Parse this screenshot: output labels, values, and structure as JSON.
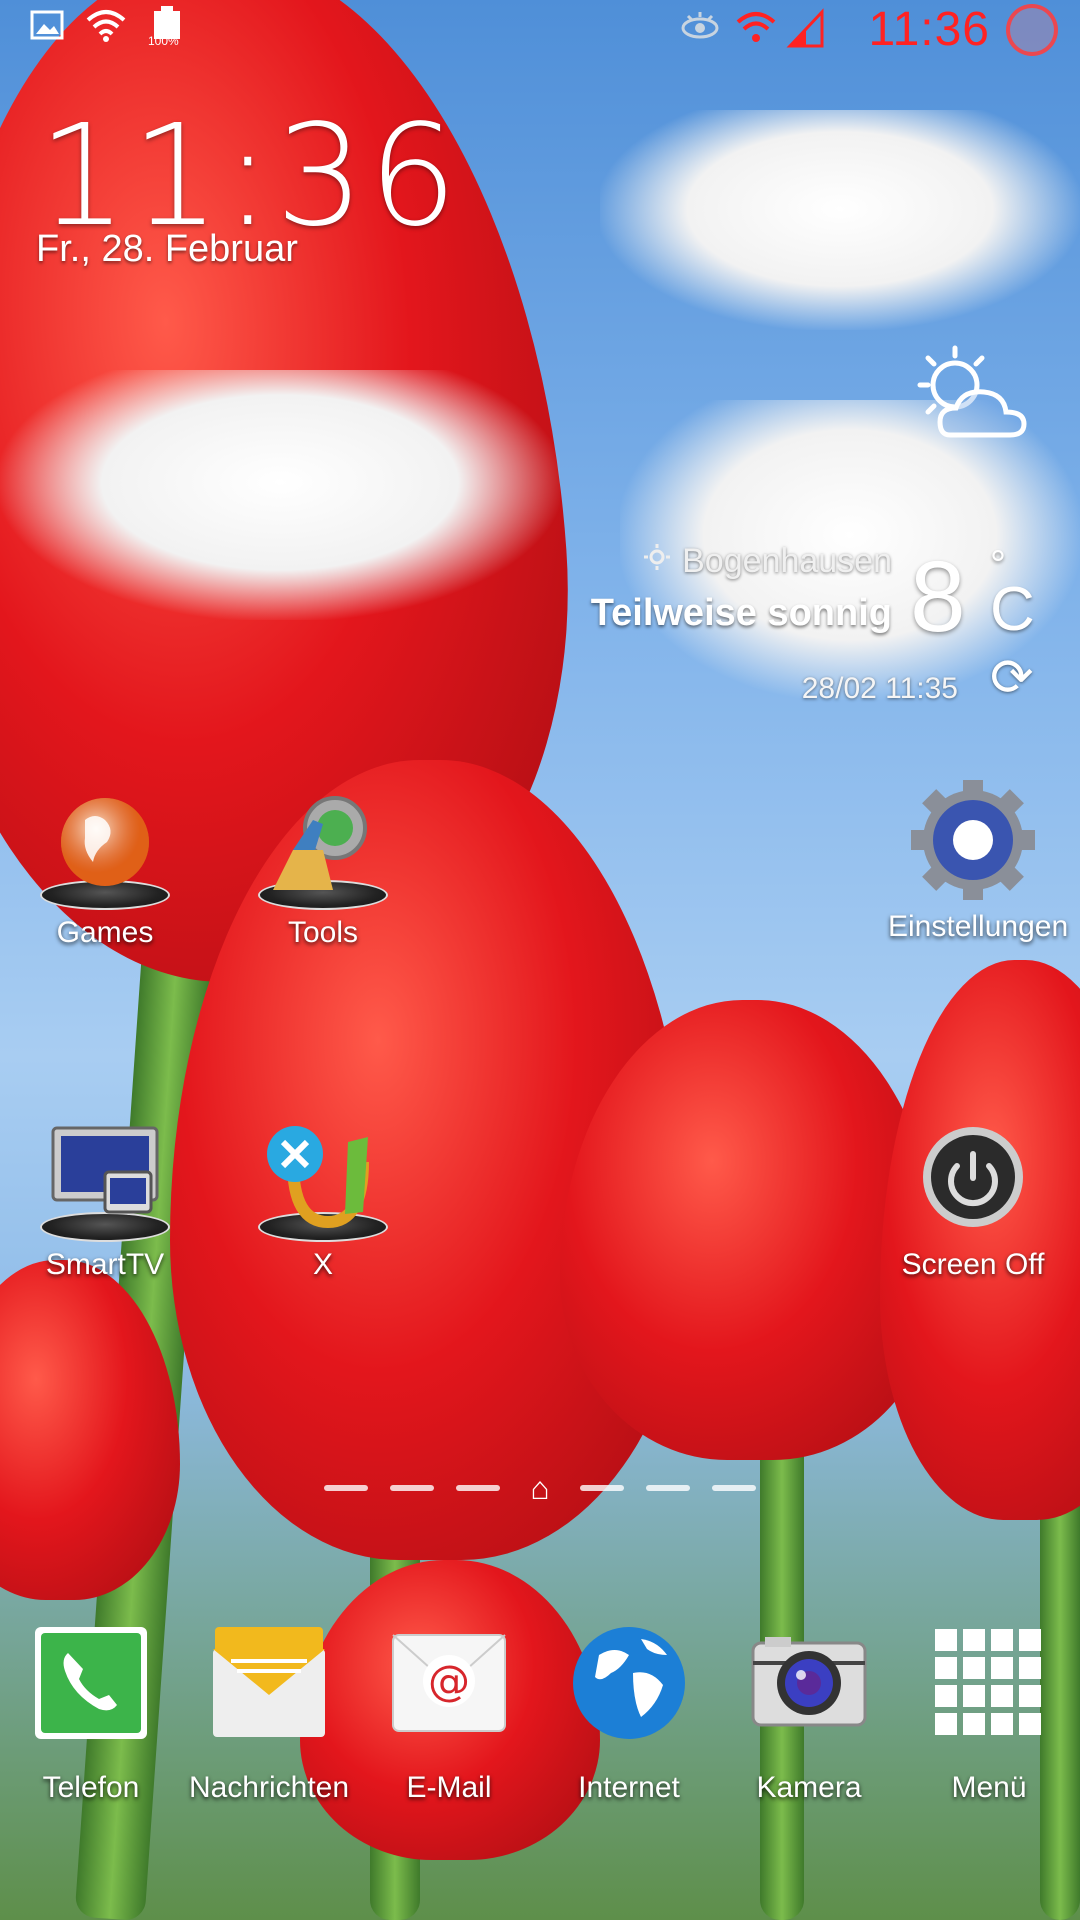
{
  "status_bar": {
    "time": "11:36",
    "battery_level": "100%",
    "icons": [
      "gallery-notification-icon",
      "wifi-icon",
      "battery-icon",
      "smart-stay-eye-icon",
      "wifi-signal-icon",
      "cell-signal-icon",
      "notification-indicator-icon"
    ]
  },
  "clock_widget": {
    "time": "11:36",
    "date": "Fr., 28. Februar"
  },
  "weather_widget": {
    "location": "Bogenhausen",
    "condition": "Teilweise sonnig",
    "temperature": "8",
    "unit_degree": "°",
    "unit": "C",
    "updated": "28/02 11:35",
    "icon": "partly-sunny-icon"
  },
  "apps": [
    {
      "label": "Games",
      "icon": "globe-icon"
    },
    {
      "label": "Tools",
      "icon": "clean-master-broom-icon"
    },
    {
      "label": "Einstellungen",
      "icon": "settings-gear-icon"
    },
    {
      "label": "SmartTV",
      "icon": "samsung-smarttv-icon"
    },
    {
      "label": "X",
      "icon": "x-app-icon"
    },
    {
      "label": "Screen Off",
      "icon": "power-icon"
    }
  ],
  "pager": {
    "pages_before": 3,
    "pages_after": 3,
    "home_icon": "home-icon"
  },
  "dock": [
    {
      "label": "Telefon",
      "icon": "phone-icon"
    },
    {
      "label": "Nachrichten",
      "icon": "messages-icon"
    },
    {
      "label": "E-Mail",
      "icon": "email-icon"
    },
    {
      "label": "Internet",
      "icon": "internet-globe-icon"
    },
    {
      "label": "Kamera",
      "icon": "camera-icon"
    },
    {
      "label": "Menü",
      "icon": "app-drawer-icon"
    }
  ],
  "colors": {
    "status_time": "#ff2222",
    "sky": "#7fb2ea",
    "tulip": "#e3161c"
  }
}
